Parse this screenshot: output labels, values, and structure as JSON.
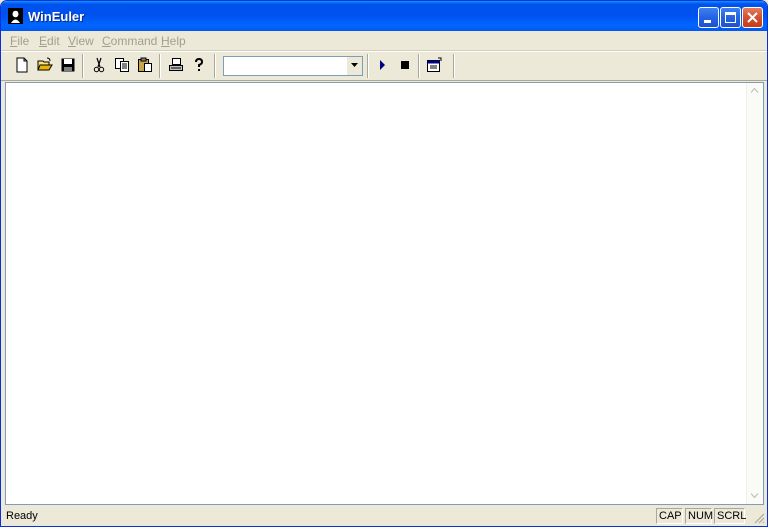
{
  "window": {
    "title": "WinEuler"
  },
  "menu": {
    "items": [
      {
        "label": "File",
        "hotkey": "F",
        "rest": "ile"
      },
      {
        "label": "Edit",
        "hotkey": "E",
        "rest": "dit"
      },
      {
        "label": "View",
        "hotkey": "V",
        "rest": "iew"
      },
      {
        "label": "Command",
        "hotkey": "C",
        "rest": "ommand"
      },
      {
        "label": "Help",
        "hotkey": "H",
        "rest": "elp"
      }
    ]
  },
  "toolbar": {
    "command_combo_value": "",
    "icons": [
      "new-file-icon",
      "open-folder-icon",
      "save-disk-icon",
      "cut-scissors-icon",
      "copy-icon",
      "paste-icon",
      "print-icon",
      "help-question-icon",
      "run-play-icon",
      "stop-icon",
      "properties-icon"
    ]
  },
  "status": {
    "text": "Ready",
    "indicators": [
      "CAP",
      "NUM",
      "SCRL"
    ]
  },
  "colors": {
    "titlebar": "#0054E3",
    "face": "#ECE9D8",
    "close": "#D3502F",
    "disabled_menu": "#A19F94"
  }
}
